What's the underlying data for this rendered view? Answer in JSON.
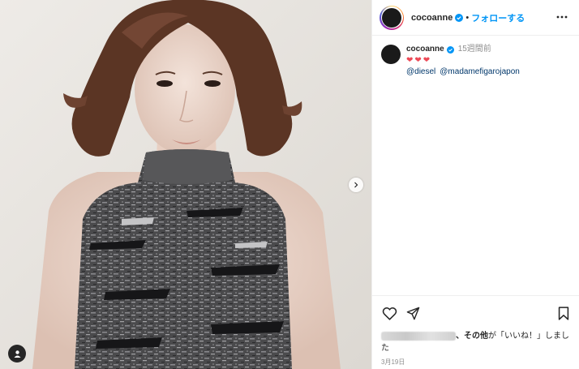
{
  "post": {
    "username": "cocoanne",
    "follow_label": "フォローする",
    "separator": "•",
    "caption": {
      "username": "cocoanne",
      "time_ago": "15週間前",
      "hearts": "❤❤❤",
      "mentions": [
        "@diesel",
        "@madamefigarojapon"
      ]
    },
    "likes": {
      "and_others": "、その他",
      "suffix": "が「いいね！」しました"
    },
    "date": "3月19日"
  },
  "colors": {
    "accent": "#0095f6",
    "heart": "#ed4956",
    "mention": "#00376b",
    "muted": "#8e8e8e"
  },
  "icons": [
    "verified-badge-icon",
    "more-options-icon",
    "heart-icon",
    "share-icon",
    "bookmark-icon",
    "chevron-right-icon",
    "user-tag-icon"
  ]
}
